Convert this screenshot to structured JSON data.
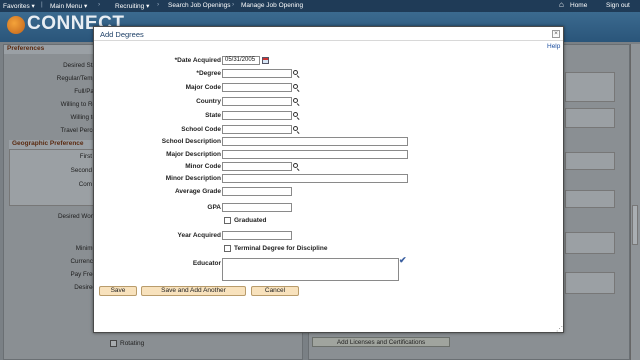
{
  "topbar": {
    "favorites": "Favorites ▾",
    "main_menu": "Main Menu ▾",
    "recruiting": "Recruiting ▾",
    "search_job_openings": "Search Job Openings",
    "manage_job_opening": "Manage Job Opening",
    "home": "Home",
    "sign_out": "Sign out"
  },
  "brand": {
    "logo_text": "CONNECT"
  },
  "background": {
    "preferences_header": "Preferences",
    "geographic_header": "Geographic Preference",
    "labels": [
      "Desired Sta",
      "Regular/Temp",
      "Full/Par",
      "Willing to Re",
      "Willing to",
      "Travel Perce"
    ],
    "geo_labels": [
      "First",
      "Second",
      "Com"
    ],
    "lower_labels": [
      "Desired Work",
      "Minimu",
      "Currency",
      "Pay Freq",
      "Desired"
    ],
    "rotating_label": "Rotating",
    "licenses_button": "Add Licenses and Certifications"
  },
  "modal": {
    "title": "Add Degrees",
    "help": "Help",
    "fields": {
      "date_acquired_label": "*Date Acquired",
      "date_acquired_value": "05/31/2005",
      "degree_label": "*Degree",
      "major_code_label": "Major Code",
      "country_label": "Country",
      "state_label": "State",
      "school_code_label": "School Code",
      "school_description_label": "School Description",
      "major_description_label": "Major Description",
      "minor_code_label": "Minor Code",
      "minor_description_label": "Minor Description",
      "average_grade_label": "Average Grade",
      "gpa_label": "GPA",
      "graduated_label": "Graduated",
      "year_acquired_label": "Year Acquired",
      "terminal_degree_label": "Terminal Degree for Discipline",
      "educator_label": "Educator"
    },
    "buttons": {
      "save": "Save",
      "save_and_add_another": "Save and Add Another",
      "cancel": "Cancel"
    }
  },
  "colors": {
    "brand_bar": "#2a557a",
    "button_fill": "#f8e2bd",
    "modal_title": "#1d3f66"
  }
}
